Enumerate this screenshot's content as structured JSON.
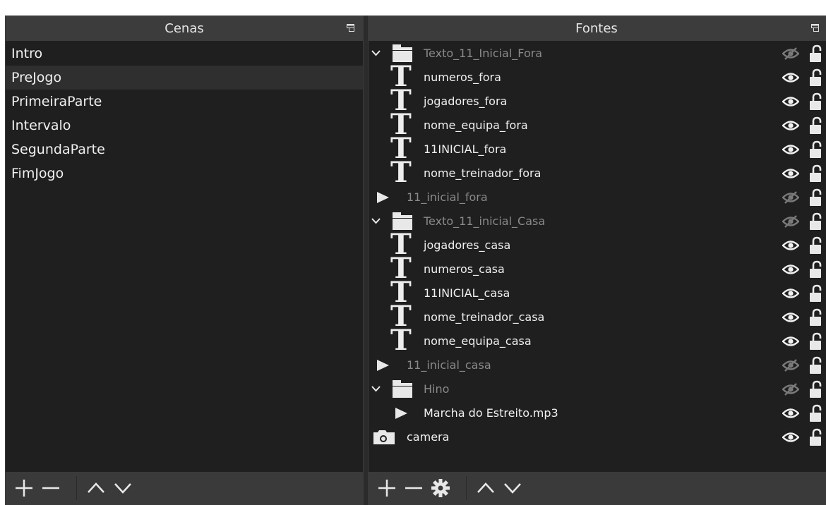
{
  "scenes": {
    "title": "Cenas",
    "items": [
      {
        "label": "Intro",
        "selected": false
      },
      {
        "label": "PreJogo",
        "selected": true
      },
      {
        "label": "PrimeiraParte",
        "selected": false
      },
      {
        "label": "Intervalo",
        "selected": false
      },
      {
        "label": "SegundaParte",
        "selected": false
      },
      {
        "label": "FimJogo",
        "selected": false
      }
    ]
  },
  "sources": {
    "title": "Fontes",
    "items": [
      {
        "label": "Texto_11_Inicial_Fora",
        "type": "group",
        "visible": false
      },
      {
        "label": "numeros_fora",
        "type": "text",
        "visible": true
      },
      {
        "label": "jogadores_fora",
        "type": "text",
        "visible": true
      },
      {
        "label": "nome_equipa_fora",
        "type": "text",
        "visible": true
      },
      {
        "label": "11INICIAL_fora",
        "type": "text",
        "visible": true
      },
      {
        "label": "nome_treinador_fora",
        "type": "text",
        "visible": true
      },
      {
        "label": "11_inicial_fora",
        "type": "media",
        "visible": false
      },
      {
        "label": "Texto_11_inicial_Casa",
        "type": "group",
        "visible": false
      },
      {
        "label": "jogadores_casa",
        "type": "text",
        "visible": true
      },
      {
        "label": "numeros_casa",
        "type": "text",
        "visible": true
      },
      {
        "label": "11INICIAL_casa",
        "type": "text",
        "visible": true
      },
      {
        "label": "nome_treinador_casa",
        "type": "text",
        "visible": true
      },
      {
        "label": "nome_equipa_casa",
        "type": "text",
        "visible": true
      },
      {
        "label": "11_inicial_casa",
        "type": "media",
        "visible": false
      },
      {
        "label": "Hino",
        "type": "group",
        "visible": false
      },
      {
        "label": "Marcha do Estreito.mp3",
        "type": "media-child",
        "visible": true
      },
      {
        "label": "camera",
        "type": "camera",
        "visible": true
      }
    ]
  },
  "icons": {
    "float": "float-icon",
    "eye": "eye-icon",
    "eye_hidden": "eye-hidden-icon",
    "lock": "unlock-icon"
  },
  "colors": {
    "panel_bg": "#1f1f1f",
    "header_bg": "#3c3c3c",
    "toolbar_bg": "#3a3a3a",
    "selected_bg": "#2f2f2f",
    "text": "#f0f0f0",
    "dim_text": "#8a8a8a"
  }
}
